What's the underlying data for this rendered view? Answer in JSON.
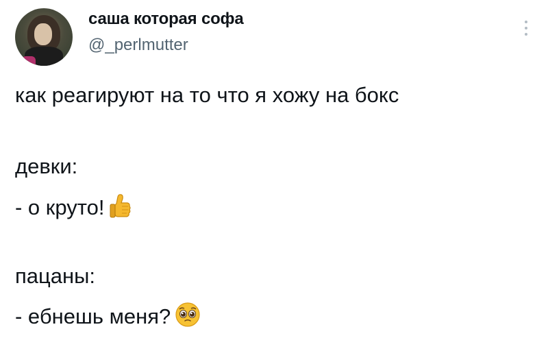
{
  "author": {
    "display_name": "саша которая софа",
    "handle": "@_perlmutter"
  },
  "tweet": {
    "line1": "как реагируют на то что я хожу на бокс",
    "line2": "девки:",
    "line3": "- о круто!",
    "line4": "пацаны:",
    "line5": "- ебнешь меня?"
  },
  "icons": {
    "more": "more-vertical-icon",
    "thumbs_up": "thumbs-up-emoji",
    "pleading_face": "pleading-face-emoji"
  },
  "colors": {
    "text": "#0f1419",
    "secondary_text": "#536471",
    "emoji_yellow": "#f5b82e"
  }
}
